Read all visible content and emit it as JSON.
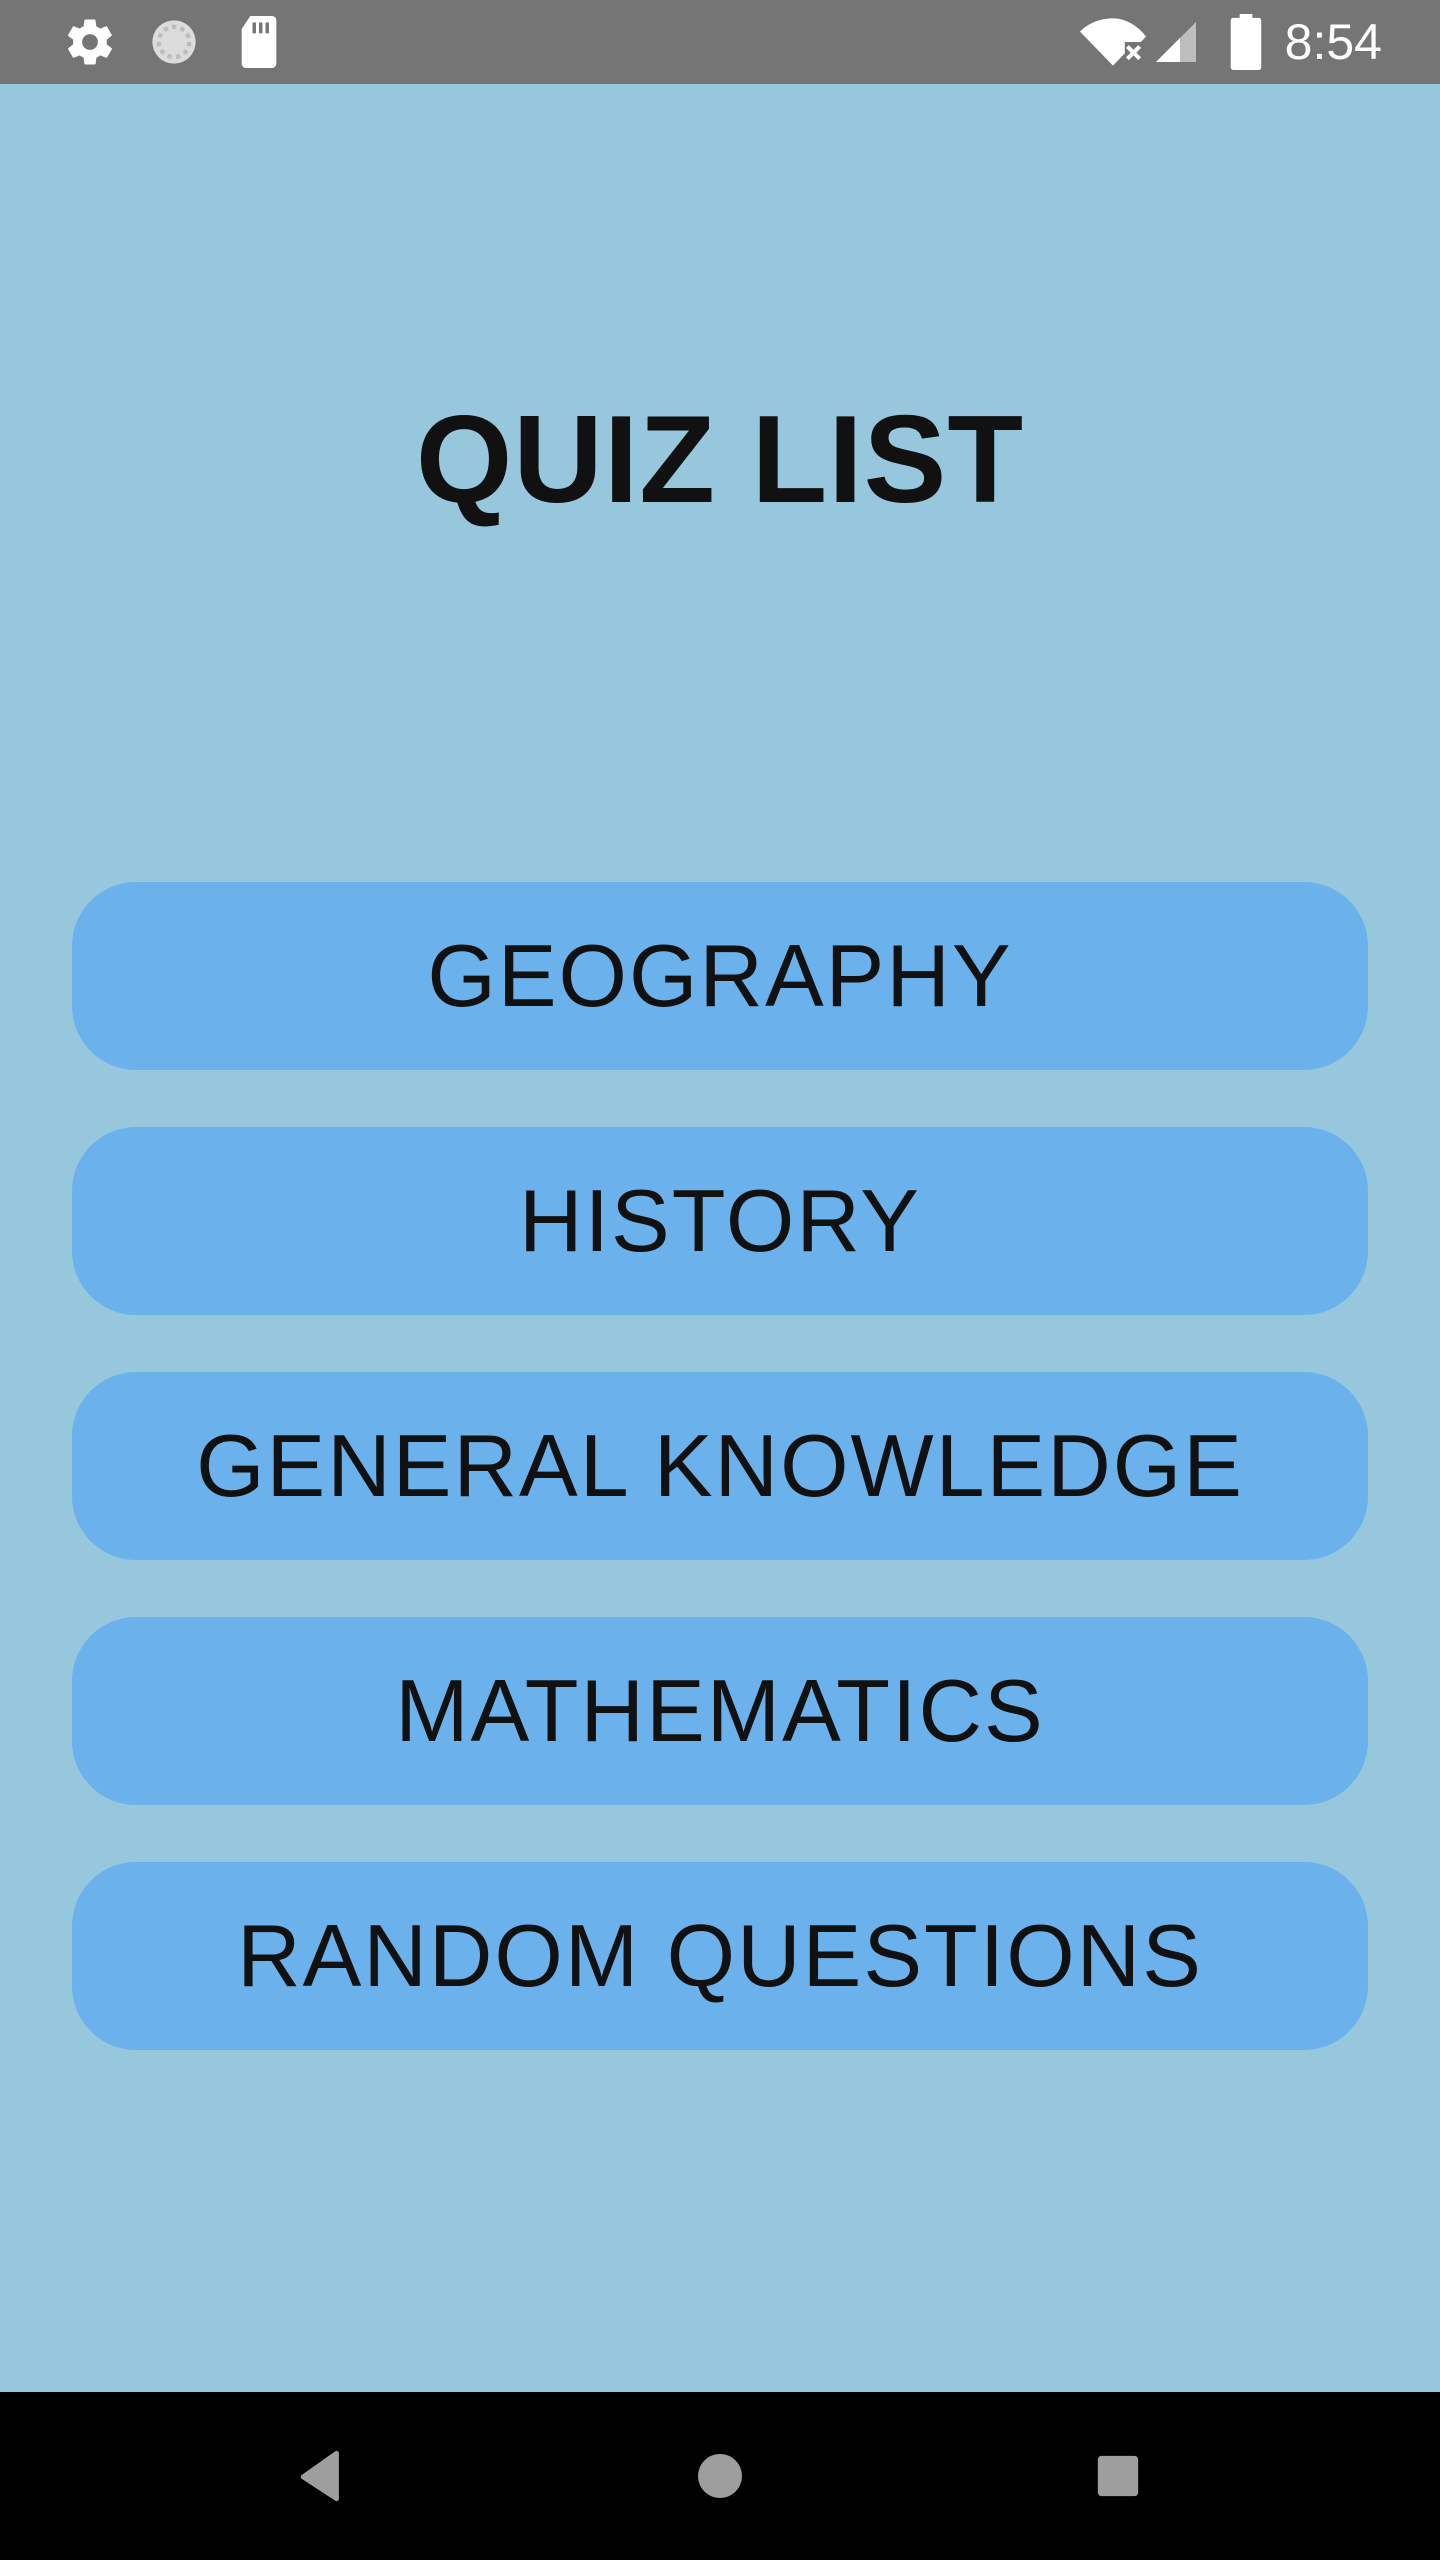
{
  "status_bar": {
    "time": "8:54",
    "icons": [
      "gear-icon",
      "sync-circle-icon",
      "sd-card-icon",
      "wifi-off-icon",
      "signal-icon",
      "battery-icon"
    ]
  },
  "title": "QUIZ LIST",
  "quizzes": [
    {
      "label": "GEOGRAPHY"
    },
    {
      "label": "HISTORY"
    },
    {
      "label": "GENERAL KNOWLEDGE"
    },
    {
      "label": "MATHEMATICS"
    },
    {
      "label": "RANDOM QUESTIONS"
    }
  ],
  "nav_bar": {
    "icons": [
      "back-icon",
      "home-icon",
      "recents-icon"
    ]
  },
  "colors": {
    "background": "#96c7dc",
    "button": "#6bb1ec",
    "status_bar": "#757575",
    "nav_bar": "#000000"
  }
}
